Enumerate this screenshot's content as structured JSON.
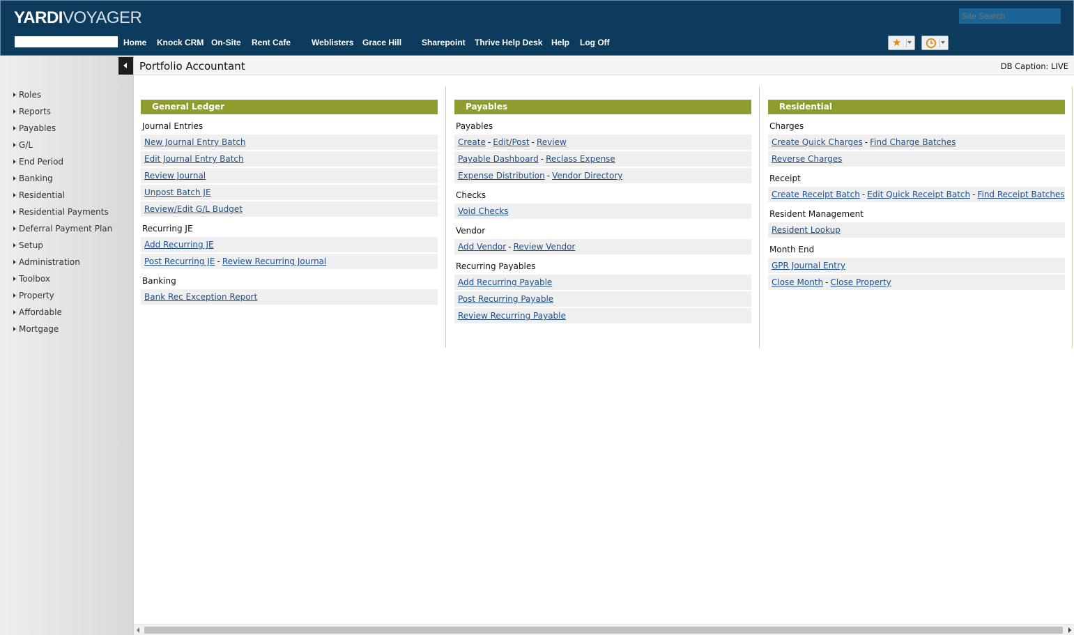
{
  "header": {
    "logo_bold": "YARDI",
    "logo_light": "VOYAGER",
    "search_placeholder": "Site Search",
    "nav": [
      "Home",
      "Knock CRM",
      "On-Site",
      "Rent Cafe",
      "Weblisters",
      "Grace Hill",
      "Sharepoint",
      "Thrive Help Desk",
      "Help",
      "Log Off"
    ],
    "favorites_icon": "star-icon",
    "history_icon": "clock-icon"
  },
  "sidebar": {
    "items": [
      "Roles",
      "Reports",
      "Payables",
      "G/L",
      "End Period",
      "Banking",
      "Residential",
      "Residential Payments",
      "Deferral Payment Plan",
      "Setup",
      "Administration",
      "Toolbox",
      "Property",
      "Affordable",
      "Mortgage"
    ]
  },
  "titlebar": {
    "title": "Portfolio Accountant",
    "db_caption": "DB Caption: LIVE"
  },
  "columns": [
    {
      "header": "General Ledger",
      "groups": [
        {
          "title": "Journal Entries",
          "rows": [
            [
              "New Journal Entry Batch"
            ],
            [
              "Edit Journal Entry Batch"
            ],
            [
              "Review Journal"
            ],
            [
              "Unpost Batch JE"
            ],
            [
              "Review/Edit G/L Budget"
            ]
          ]
        },
        {
          "title": "Recurring JE",
          "rows": [
            [
              "Add Recurring JE"
            ],
            [
              "Post Recurring JE",
              "Review Recurring Journal"
            ]
          ]
        },
        {
          "title": "Banking",
          "rows": [
            [
              "Bank Rec Exception Report"
            ]
          ]
        }
      ]
    },
    {
      "header": "Payables",
      "groups": [
        {
          "title": "Payables",
          "rows": [
            [
              "Create",
              "Edit/Post",
              "Review"
            ],
            [
              "Payable Dashboard",
              "Reclass Expense"
            ],
            [
              "Expense Distribution",
              "Vendor Directory"
            ]
          ]
        },
        {
          "title": "Checks",
          "rows": [
            [
              "Void Checks"
            ]
          ]
        },
        {
          "title": "Vendor",
          "rows": [
            [
              "Add Vendor",
              "Review Vendor"
            ]
          ]
        },
        {
          "title": "Recurring Payables",
          "rows": [
            [
              "Add Recurring Payable"
            ],
            [
              "Post Recurring Payable"
            ],
            [
              "Review Recurring Payable"
            ]
          ]
        }
      ]
    },
    {
      "header": "Residential",
      "groups": [
        {
          "title": "Charges",
          "rows": [
            [
              "Create Quick Charges",
              "Find Charge Batches"
            ],
            [
              "Reverse Charges"
            ]
          ]
        },
        {
          "title": "Receipt",
          "rows": [
            [
              "Create Receipt Batch",
              "Edit Quick Receipt Batch",
              "Find Receipt Batches"
            ]
          ]
        },
        {
          "title": "Resident Management",
          "rows": [
            [
              "Resident Lookup"
            ]
          ]
        },
        {
          "title": "Month End",
          "rows": [
            [
              "GPR Journal Entry"
            ],
            [
              "Close Month",
              "Close Property"
            ]
          ]
        }
      ]
    }
  ],
  "colors": {
    "header_bg": "#0d3b5e",
    "section_header": "#8e9d2b",
    "link": "#1f4f8a"
  }
}
